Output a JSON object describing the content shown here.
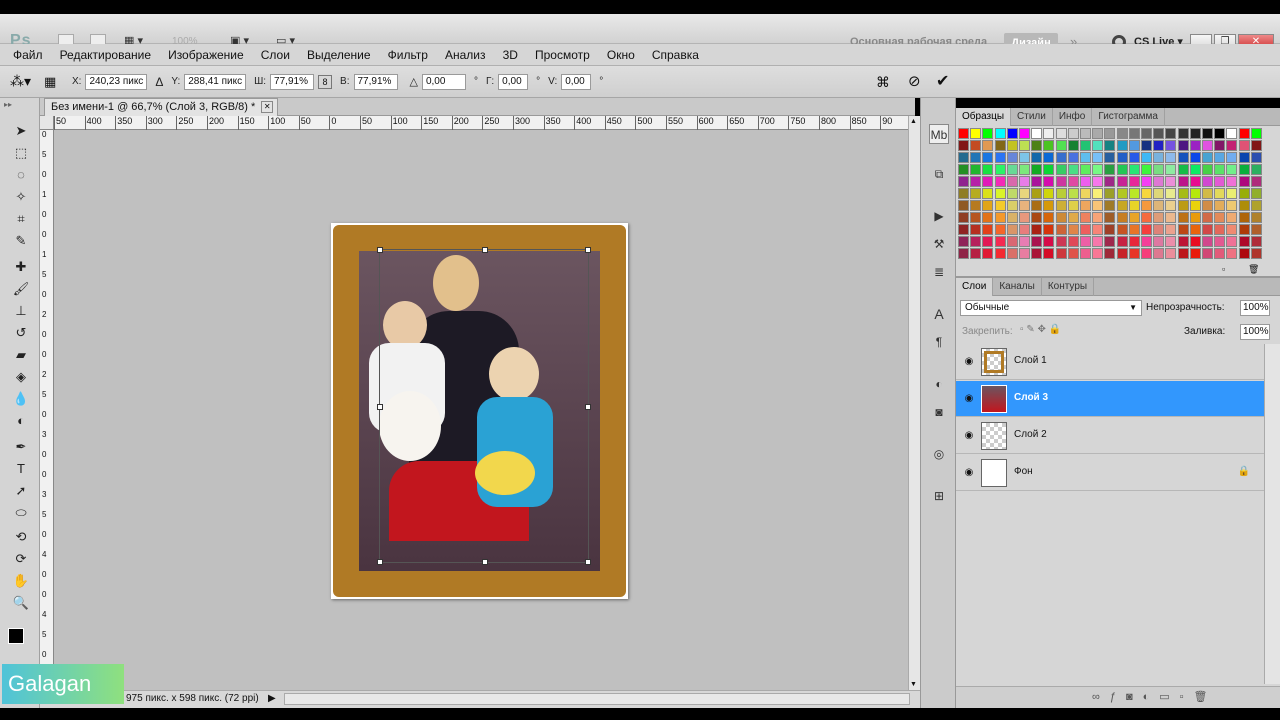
{
  "app": {
    "logo": "Ps",
    "zoom": "100%",
    "workspace_label": "Основная рабочая среда",
    "design_label": "Дизайн",
    "cslive_label": "CS Live"
  },
  "menu": [
    "Файл",
    "Редактирование",
    "Изображение",
    "Слои",
    "Выделение",
    "Фильтр",
    "Анализ",
    "3D",
    "Просмотр",
    "Окно",
    "Справка"
  ],
  "options": {
    "x_label": "X:",
    "x_value": "240,23 пикс",
    "y_label": "Y:",
    "y_value": "288,41 пикс",
    "w_label": "Ш:",
    "w_value": "77,91%",
    "h_label": "В:",
    "h_value": "77,91%",
    "angle_value": "0,00",
    "deg": "°",
    "g_label": "Г:",
    "g_value": "0,00",
    "v_label": "V:",
    "v_value": "0,00"
  },
  "document": {
    "tab_title": "Без имени-1 @ 66,7% (Слой 3, RGB/8) *",
    "status": "975 пикс. x 598 пикс. (72 ppi)"
  },
  "ruler_h": [
    "50",
    "400",
    "350",
    "300",
    "250",
    "200",
    "150",
    "100",
    "50",
    "0",
    "50",
    "100",
    "150",
    "200",
    "250",
    "300",
    "350",
    "400",
    "450",
    "500",
    "550",
    "600",
    "650",
    "700",
    "750",
    "800",
    "850",
    "90"
  ],
  "ruler_v": [
    "0",
    "5",
    "0",
    "1",
    "0",
    "0",
    "1",
    "5",
    "0",
    "2",
    "0",
    "0",
    "2",
    "5",
    "0",
    "3",
    "0",
    "0",
    "3",
    "5",
    "0",
    "4",
    "0",
    "0",
    "4",
    "5",
    "0"
  ],
  "swatch_panel": {
    "tabs": [
      "Образцы",
      "Стили",
      "Инфо",
      "Гистограмма"
    ]
  },
  "layers_panel": {
    "tabs": [
      "Слои",
      "Каналы",
      "Контуры"
    ],
    "blend_mode": "Обычные",
    "opacity_label": "Непрозрачность:",
    "opacity_value": "100%",
    "lock_label": "Закрепить:",
    "fill_label": "Заливка:",
    "fill_value": "100%",
    "layers": [
      {
        "name": "Слой 1",
        "selected": false
      },
      {
        "name": "Слой 3",
        "selected": true
      },
      {
        "name": "Слой 2",
        "selected": false
      },
      {
        "name": "Фон",
        "selected": false
      }
    ]
  },
  "watermark": "Galagan",
  "colors": {
    "accent": "#3297fd",
    "foreground": "#000000",
    "background_swatch": "#e31b1b"
  }
}
